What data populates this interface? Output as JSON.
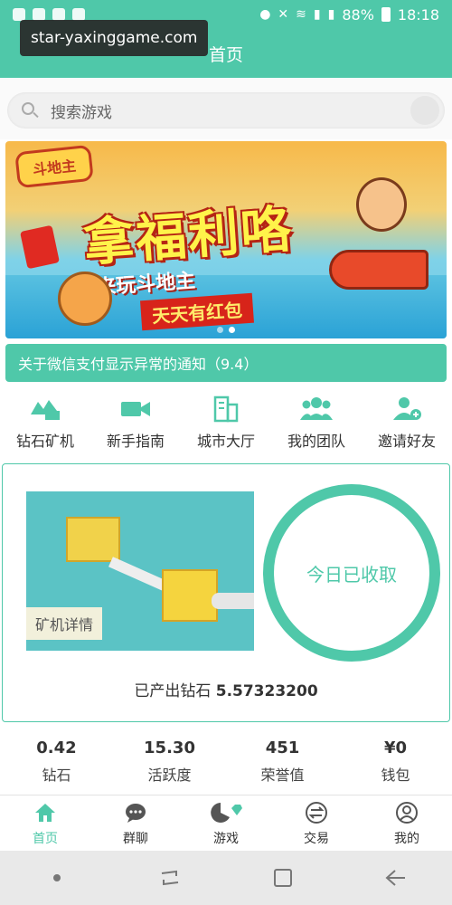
{
  "status_bar": {
    "battery": "88%",
    "time": "18:18"
  },
  "overlay": {
    "url": "star-yaxinggame.com"
  },
  "header": {
    "title": "首页"
  },
  "search": {
    "placeholder": "搜索游戏"
  },
  "banner": {
    "logo_text": "斗地主",
    "title": "拿福利咯",
    "subtitle1": "来玩斗地主",
    "subtitle2": "天天有红包"
  },
  "notice": {
    "text": "关于微信支付显示异常的通知（9.4）"
  },
  "menu": {
    "items": [
      {
        "label": "钻石矿机",
        "icon": "diamond-mine-icon"
      },
      {
        "label": "新手指南",
        "icon": "video-camera-icon"
      },
      {
        "label": "城市大厅",
        "icon": "building-icon"
      },
      {
        "label": "我的团队",
        "icon": "team-icon"
      },
      {
        "label": "邀请好友",
        "icon": "add-user-icon"
      }
    ]
  },
  "mining": {
    "detail_label": "矿机详情",
    "collect_status": "今日已收取",
    "produced_label": "已产出钻石",
    "produced_value": "5.57323200"
  },
  "stats": [
    {
      "value": "0.42",
      "label": "钻石"
    },
    {
      "value": "15.30",
      "label": "活跃度"
    },
    {
      "value": "451",
      "label": "荣誉值"
    },
    {
      "value": "¥0",
      "label": "钱包"
    }
  ],
  "tabbar": {
    "items": [
      {
        "label": "首页",
        "icon": "home-icon"
      },
      {
        "label": "群聊",
        "icon": "chat-icon"
      },
      {
        "label": "游戏",
        "icon": "game-icon"
      },
      {
        "label": "交易",
        "icon": "exchange-icon"
      },
      {
        "label": "我的",
        "icon": "profile-icon"
      }
    ]
  },
  "colors": {
    "accent": "#4fc8a9",
    "text": "#333333"
  }
}
